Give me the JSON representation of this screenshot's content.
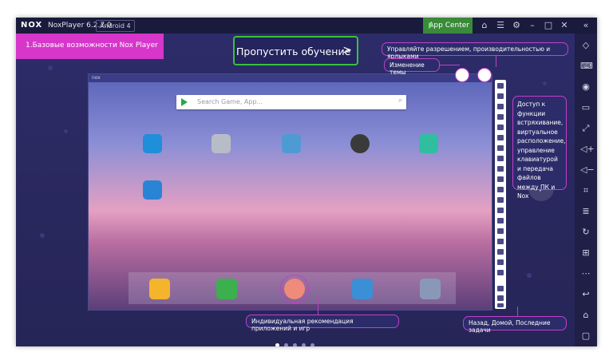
{
  "titlebar": {
    "logo": "NOX",
    "app_name": "NoxPlayer 6.2.7.0",
    "android_label": "Android 4",
    "app_center": "App Center"
  },
  "tutorial": {
    "step_title": "1.Базовые возможности Nox Player",
    "skip_label": "Пропустить обучение",
    "skip_arrow": ">"
  },
  "phone": {
    "status_logo": "nox",
    "search_placeholder": "Search Game, App..."
  },
  "callouts": {
    "manage": "Управляйте разрешением, производительностью и ярлыками",
    "theme": "Изменение темы",
    "access": "Доступ к функции встряхивание, виртуальное расположение, управление клавиатурой и передача файлов между ПК и Nox",
    "recommend": "Индивидуальная рекомендация приложений и игр",
    "nav": "Назад, Домой, Последние задачи"
  },
  "pager": {
    "count": 5,
    "active": 0
  },
  "colors": {
    "accent_magenta": "#d636c9",
    "accent_green": "#39c13b",
    "background": "#24245e"
  },
  "icons": {
    "sidebar": [
      "diamond-icon",
      "keyboard-icon",
      "location-icon",
      "screen-icon",
      "fullscreen-icon",
      "volume-up-icon",
      "volume-down-icon",
      "screenshot-icon",
      "layers-icon",
      "refresh-icon",
      "apk-icon",
      "more-icon",
      "back-icon",
      "home-icon",
      "recent-icon"
    ]
  }
}
